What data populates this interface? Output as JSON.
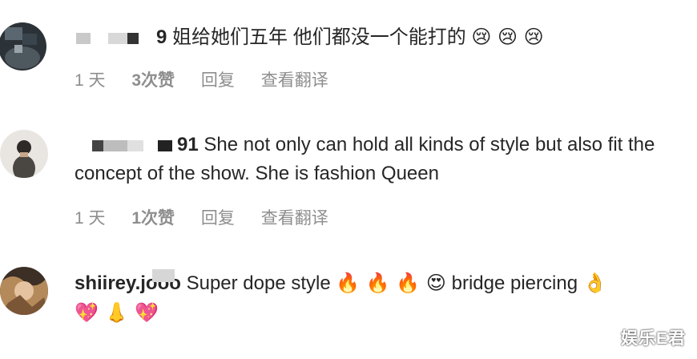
{
  "comments": [
    {
      "username_visible": "9",
      "text": " 姐给她们五年 他们都没一个能打的",
      "emojis": "😢 😢 😢",
      "time": "1 天",
      "likes": "3次赞",
      "reply": "回复",
      "translate": "查看翻译"
    },
    {
      "username_visible": "91",
      "text": " She not only can hold all kinds of style but also fit the concept of the show. She is fashion Queen",
      "time": "1 天",
      "likes": "1次赞",
      "reply": "回复",
      "translate": "查看翻译"
    },
    {
      "username_visible": "shiirey.jooo",
      "text": " Super dope style ",
      "emojis_inline": "🔥 🔥 🔥 😍",
      "text2": " bridge piercing ",
      "emojis_end": "👌",
      "emojis_line": "💖 👃 💖"
    }
  ],
  "watermark": "娱乐E君"
}
